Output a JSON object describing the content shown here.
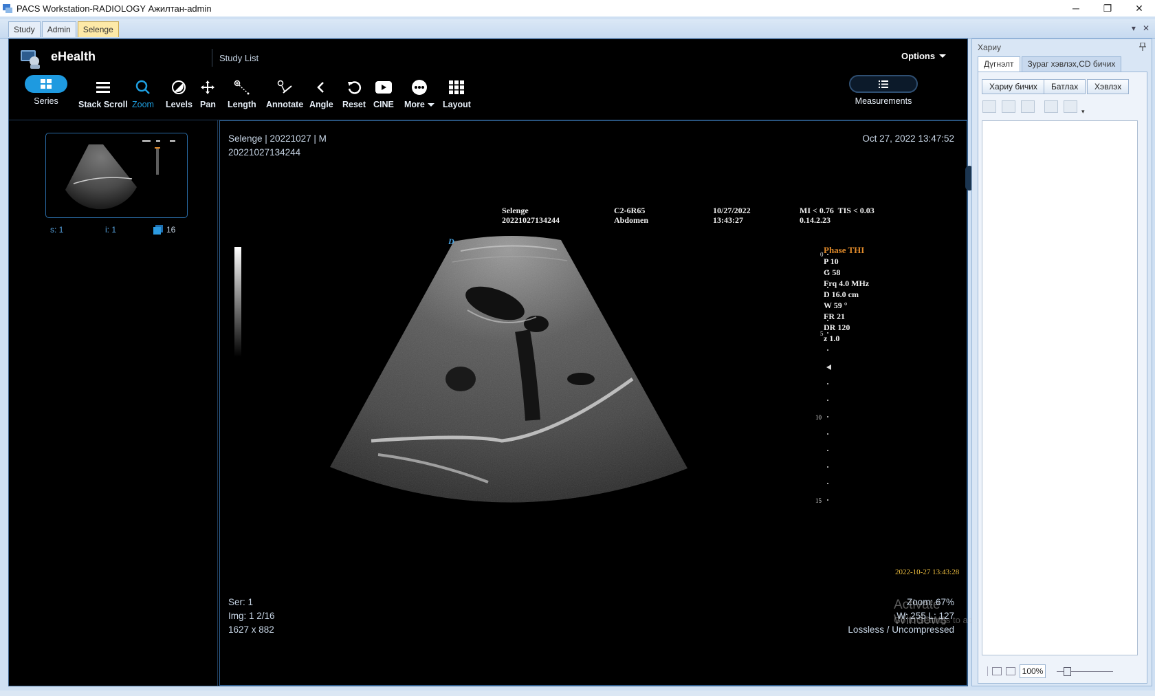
{
  "window": {
    "title": "PACS Workstation-RADIOLOGY Ажилтан-admin",
    "minimize": "─",
    "restore": "❐",
    "close": "✕"
  },
  "tabs": [
    "Study",
    "Admin",
    "Selenge"
  ],
  "tabstrip_controls": {
    "dropdown": "▾",
    "close": "✕"
  },
  "viewer": {
    "brand": "eHealth",
    "study_list": "Study List",
    "options": "Options",
    "toolbar": [
      {
        "label": "Series",
        "icon": "grid-icon"
      },
      {
        "label": "Stack Scroll",
        "icon": "menu-lines-icon"
      },
      {
        "label": "Zoom",
        "icon": "search-icon"
      },
      {
        "label": "Levels",
        "icon": "contrast-icon"
      },
      {
        "label": "Pan",
        "icon": "move-arrows-icon"
      },
      {
        "label": "Length",
        "icon": "ruler-icon"
      },
      {
        "label": "Annotate",
        "icon": "annotate-icon"
      },
      {
        "label": "Angle",
        "icon": "chevron-left-icon"
      },
      {
        "label": "Reset",
        "icon": "reset-icon"
      },
      {
        "label": "CINE",
        "icon": "play-icon"
      },
      {
        "label": "More",
        "icon": "ellipsis-icon"
      },
      {
        "label": "Layout",
        "icon": "grid-3x3-icon"
      }
    ],
    "measurements": "Measurements",
    "thumbnail": {
      "s": "s: 1",
      "i": "i: 1",
      "count": "16"
    },
    "overlay": {
      "top_left_1": "Selenge | 20221027 | M",
      "top_left_2": "20221027134244",
      "top_right": "Oct 27, 2022 13:47:52",
      "bottom_left_1": "Ser: 1",
      "bottom_left_2": "Img: 1 2/16",
      "bottom_left_3": "1627 x 882",
      "bottom_right_1": "Zoom: 67%",
      "bottom_right_2": "W: 255 L: 127",
      "bottom_right_3": "Lossless / Uncompressed"
    },
    "ultrasound": {
      "patient": "Selenge",
      "patient_id": "20221027134244",
      "probe": "C2-6R65",
      "preset": "Abdomen",
      "date": "10/27/2022",
      "time": "13:43:27",
      "mi_tis": "MI < 0.76  TIS < 0.03",
      "version": "0.14.2.23",
      "mode": "Phase THI",
      "params": [
        "P 10",
        "G 58",
        "Frq 4.0 MHz",
        "D 16.0 cm",
        "W 59 °",
        "FR 21",
        "DR 120",
        "z 1.0"
      ],
      "depth_marks": [
        "0",
        "5",
        "10",
        "15"
      ],
      "marker": "D",
      "timestamp": "2022-10-27 13:43:28"
    },
    "watermark": {
      "line1": "Activate Windows",
      "line2": "Go to Settings to activate Windows."
    }
  },
  "right_panel": {
    "title": "Хариу",
    "pin": "📌",
    "tabs": [
      "Дүгнэлт",
      "Зураг хэвлэх,CD бичих"
    ],
    "buttons": [
      "Хариу бичих",
      "Батлах",
      "Хэвлэх"
    ],
    "zoom": "100%"
  }
}
